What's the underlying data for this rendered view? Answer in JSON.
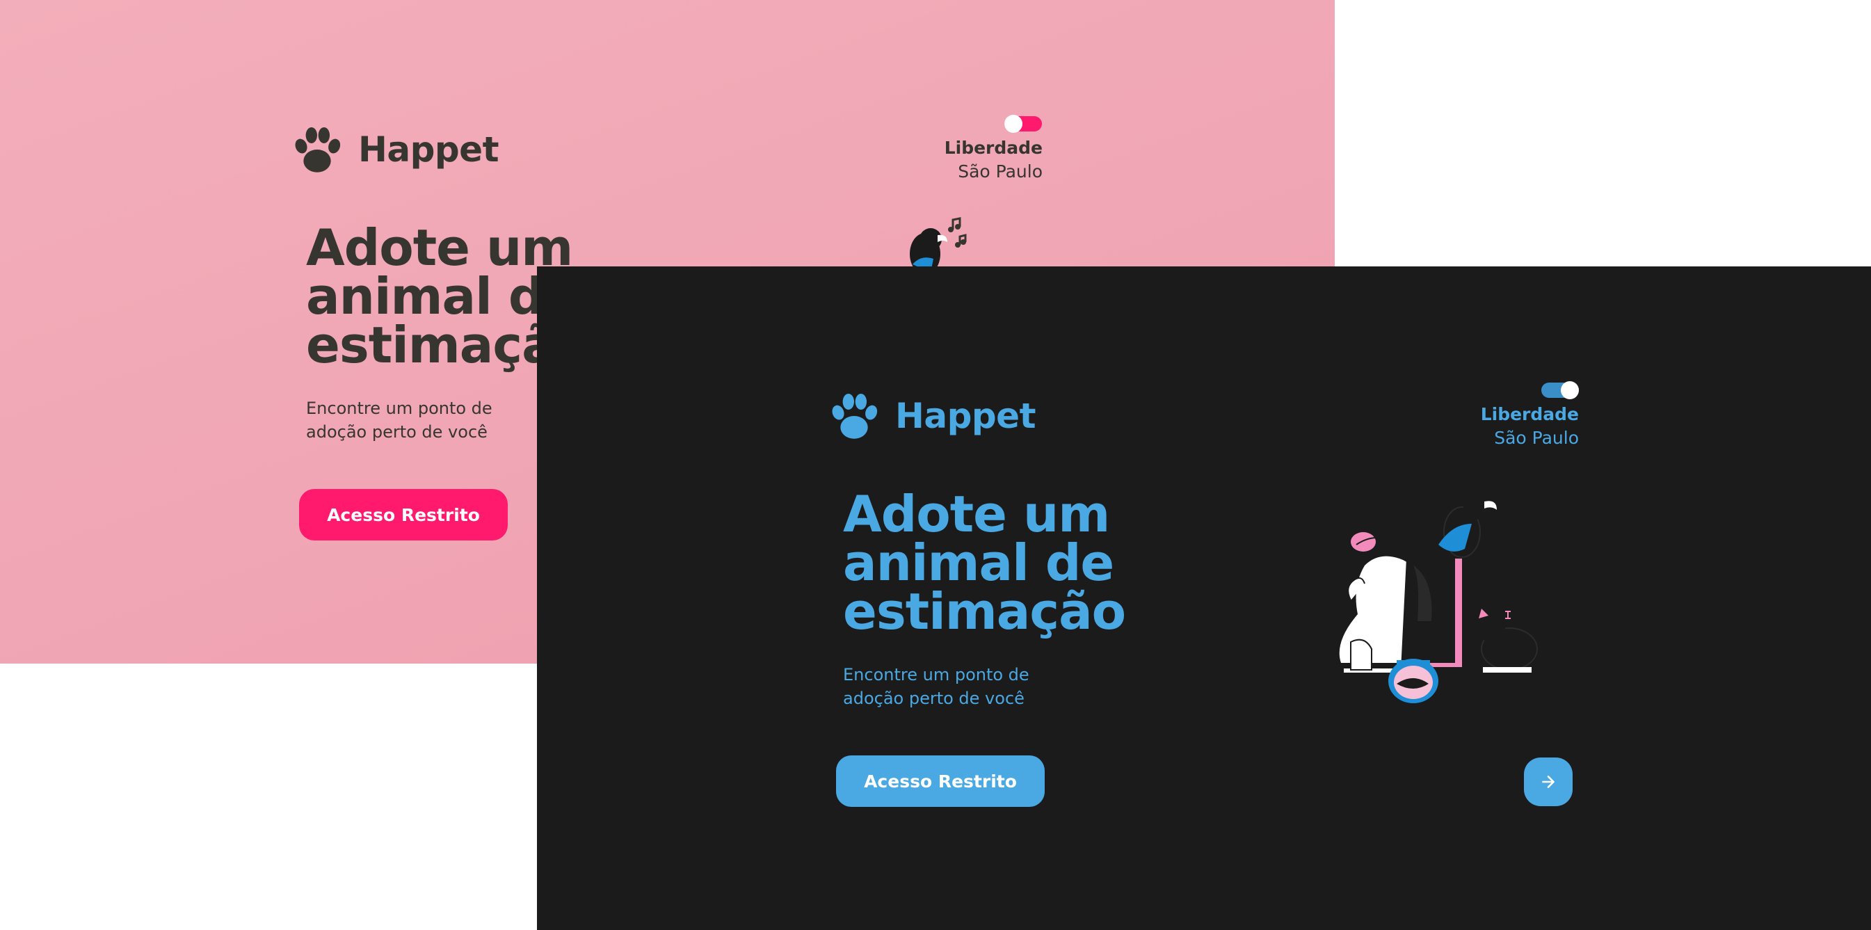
{
  "brand": {
    "name": "Happet"
  },
  "location": {
    "city": "Liberdade",
    "state": "São Paulo"
  },
  "hero": {
    "line1": "Adote um",
    "line2": "animal de",
    "line3": "estimação",
    "subtitle": "Encontre um ponto de adoção perto de você",
    "cta_label": "Acesso Restrito"
  },
  "themes": {
    "light": {
      "background": "#f1a8b6",
      "text": "#37352f",
      "accent": "#ff1a6e"
    },
    "dark": {
      "background": "#1b1b1c",
      "text": "#4aa8e3",
      "accent": "#4aa8e3"
    }
  },
  "icons": {
    "logo": "paw-icon",
    "next": "arrow-right-icon"
  }
}
